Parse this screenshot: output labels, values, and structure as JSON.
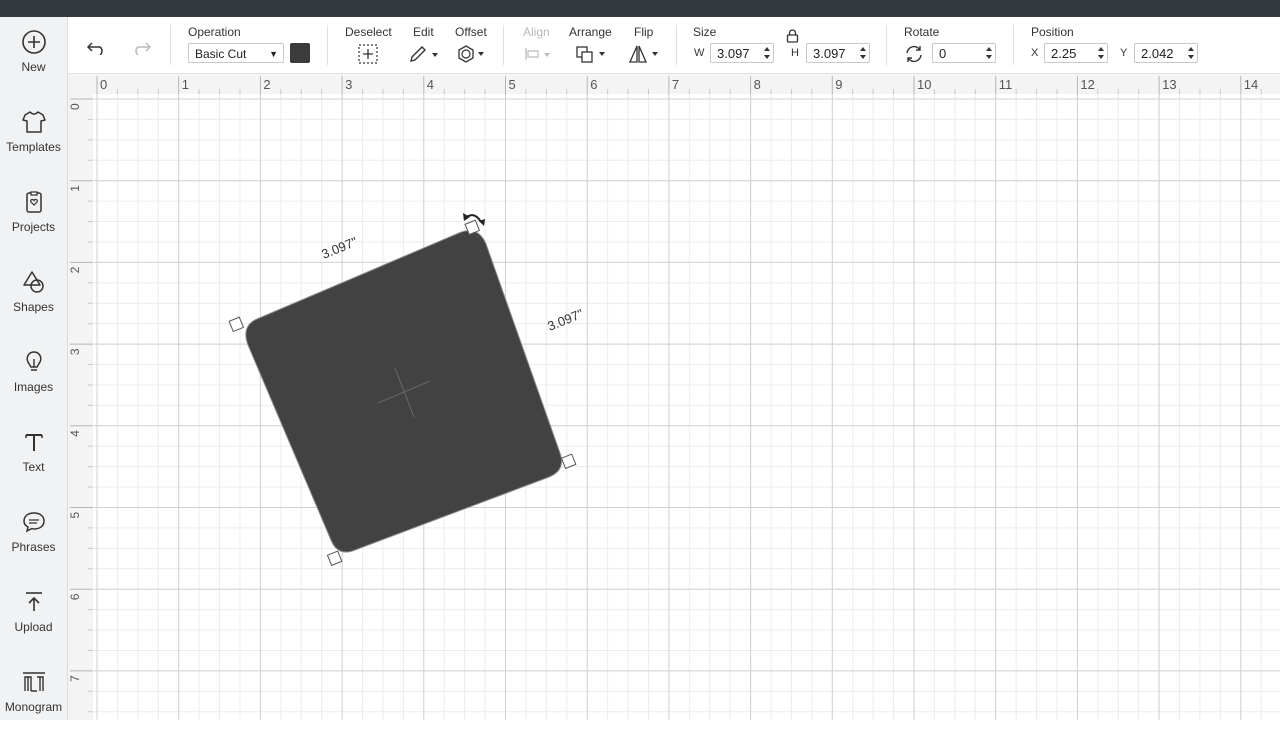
{
  "sidebar": {
    "items": [
      {
        "label": "New",
        "icon": "plus-circle-icon"
      },
      {
        "label": "Templates",
        "icon": "tshirt-icon"
      },
      {
        "label": "Projects",
        "icon": "projects-icon"
      },
      {
        "label": "Shapes",
        "icon": "shapes-icon"
      },
      {
        "label": "Images",
        "icon": "lightbulb-icon"
      },
      {
        "label": "Text",
        "icon": "text-icon"
      },
      {
        "label": "Phrases",
        "icon": "speech-bubble-icon"
      },
      {
        "label": "Upload",
        "icon": "upload-icon"
      },
      {
        "label": "Monogram",
        "icon": "monogram-icon"
      }
    ]
  },
  "toolbar": {
    "operation_label": "Operation",
    "operation_value": "Basic Cut",
    "operation_color": "#3b3b3b",
    "deselect_label": "Deselect",
    "edit_label": "Edit",
    "offset_label": "Offset",
    "align_label": "Align",
    "arrange_label": "Arrange",
    "flip_label": "Flip",
    "size_label": "Size",
    "width_prefix": "W",
    "width_value": "3.097",
    "height_prefix": "H",
    "height_value": "3.097",
    "rotate_label": "Rotate",
    "rotate_value": "0",
    "position_label": "Position",
    "x_prefix": "X",
    "x_value": "2.25",
    "y_prefix": "Y",
    "y_value": "2.042"
  },
  "canvas": {
    "ruler_h": [
      "0",
      "1",
      "2",
      "3",
      "4",
      "5",
      "6",
      "7",
      "8",
      "9",
      "10",
      "11",
      "12",
      "13",
      "14"
    ],
    "ruler_v": [
      "0",
      "1",
      "2",
      "3",
      "4",
      "5",
      "6",
      "7"
    ],
    "shape_fill": "#424242",
    "dimension_top": "3.097\"",
    "dimension_right": "3.097\""
  }
}
